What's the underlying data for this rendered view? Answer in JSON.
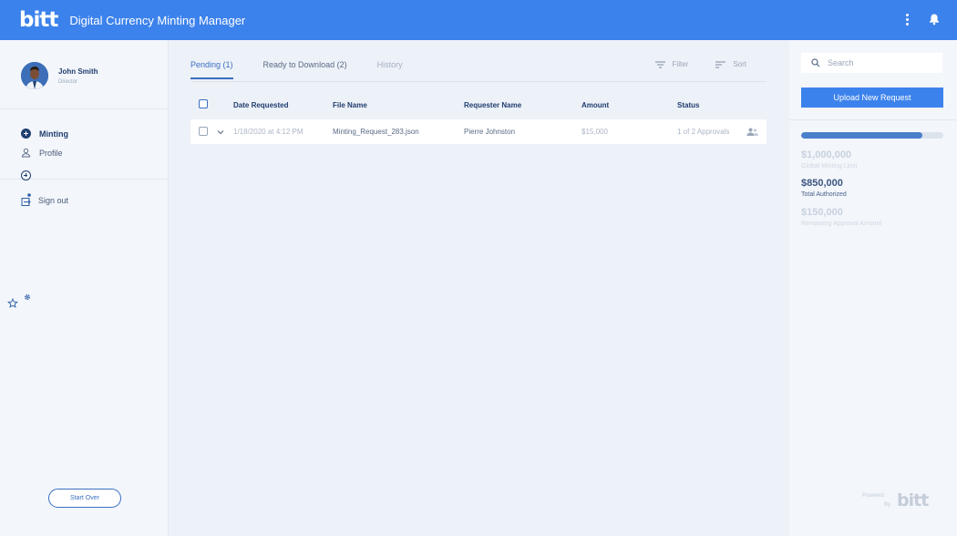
{
  "header": {
    "logo": "bitt",
    "title": "Digital Currency Minting Manager",
    "icons": [
      "more-vertical-icon",
      "bell-icon"
    ]
  },
  "user": {
    "name": "John Smith",
    "role": "Director"
  },
  "sidebar": {
    "items": [
      {
        "label": "Minting",
        "icon": "add-circle-icon",
        "active": true
      },
      {
        "label": "Profile",
        "icon": "person-icon",
        "active": false
      },
      {
        "label": "",
        "icon": "add-circle-outline-icon",
        "active": false
      },
      {
        "label": "Sign out",
        "icon": "sign-out-icon",
        "active": false
      }
    ],
    "start_over": "Start Over"
  },
  "tabs": [
    {
      "label": "Pending (1)",
      "active": true
    },
    {
      "label": "Ready to Download (2)",
      "active": false
    },
    {
      "label": "History",
      "active": false
    }
  ],
  "tools": {
    "filter": "Filter",
    "sort": "Sort"
  },
  "table": {
    "columns": [
      "Date Requested",
      "File Name",
      "Requester Name",
      "Amount",
      "Status"
    ],
    "rows": [
      {
        "date": "1/18/2020 at 4:12 PM",
        "file": "Minting_Request_283.json",
        "requester": "Pierre Johnston",
        "amount": "$15,000",
        "status": "1 of 2 Approvals"
      }
    ]
  },
  "right_panel": {
    "search_placeholder": "Search",
    "upload_label": "Upload New Request",
    "progress_fraction": 0.85,
    "stats": [
      {
        "value": "$1,000,000",
        "label": "Global Minting Limit"
      },
      {
        "value": "$850,000",
        "label": "Total Authorized"
      },
      {
        "value": "$150,000",
        "label": "Remaining Approval Amount"
      }
    ],
    "powered_line1": "Powered",
    "powered_line2": "By",
    "powered_logo": "bitt"
  },
  "colors": {
    "primary": "#3c82ec",
    "navy": "#1f3d6e",
    "main_bg": "#edf1f8",
    "panel_bg": "#f3f6fb"
  }
}
